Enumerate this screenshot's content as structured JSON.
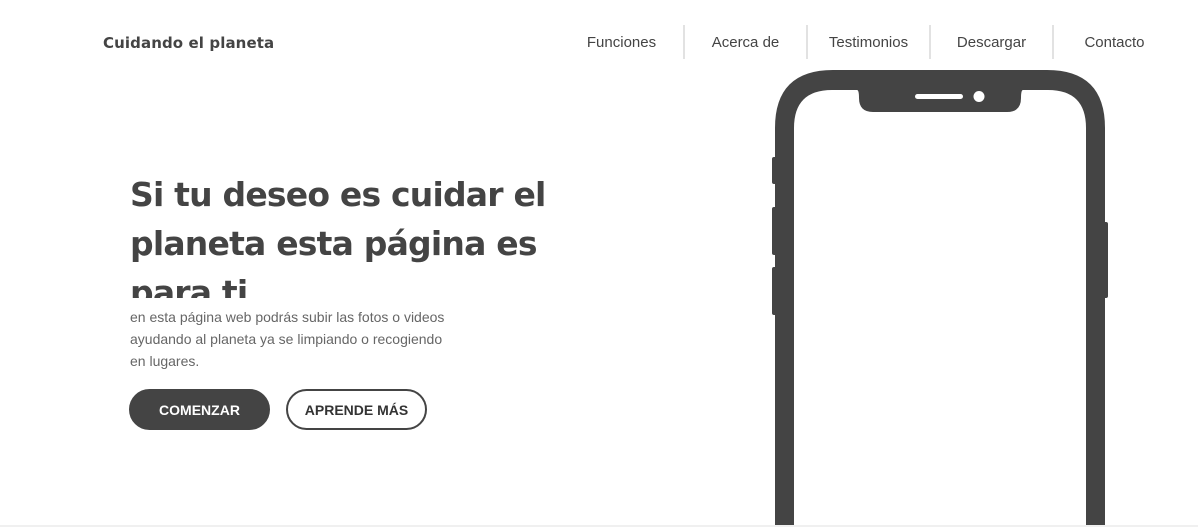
{
  "header": {
    "brand": "Cuidando el planeta",
    "nav": [
      {
        "label": "Funciones"
      },
      {
        "label": "Acerca de"
      },
      {
        "label": "Testimonios"
      },
      {
        "label": "Descargar"
      },
      {
        "label": "Contacto"
      }
    ]
  },
  "hero": {
    "title": "Si tu deseo es cuidar el planeta esta página es para ti",
    "description": "en esta página web podrás subir las fotos o videos ayudando al planeta ya se limpiando o recogiendo en lugares.",
    "primary_button": "COMENZAR",
    "secondary_button": "APRENDE MÁS"
  },
  "phone": {
    "icon": "smartphone-outline-icon",
    "color": "#444444"
  },
  "colors": {
    "text": "#444444",
    "muted_text": "#666666",
    "primary": "#444444",
    "background": "#ffffff"
  }
}
